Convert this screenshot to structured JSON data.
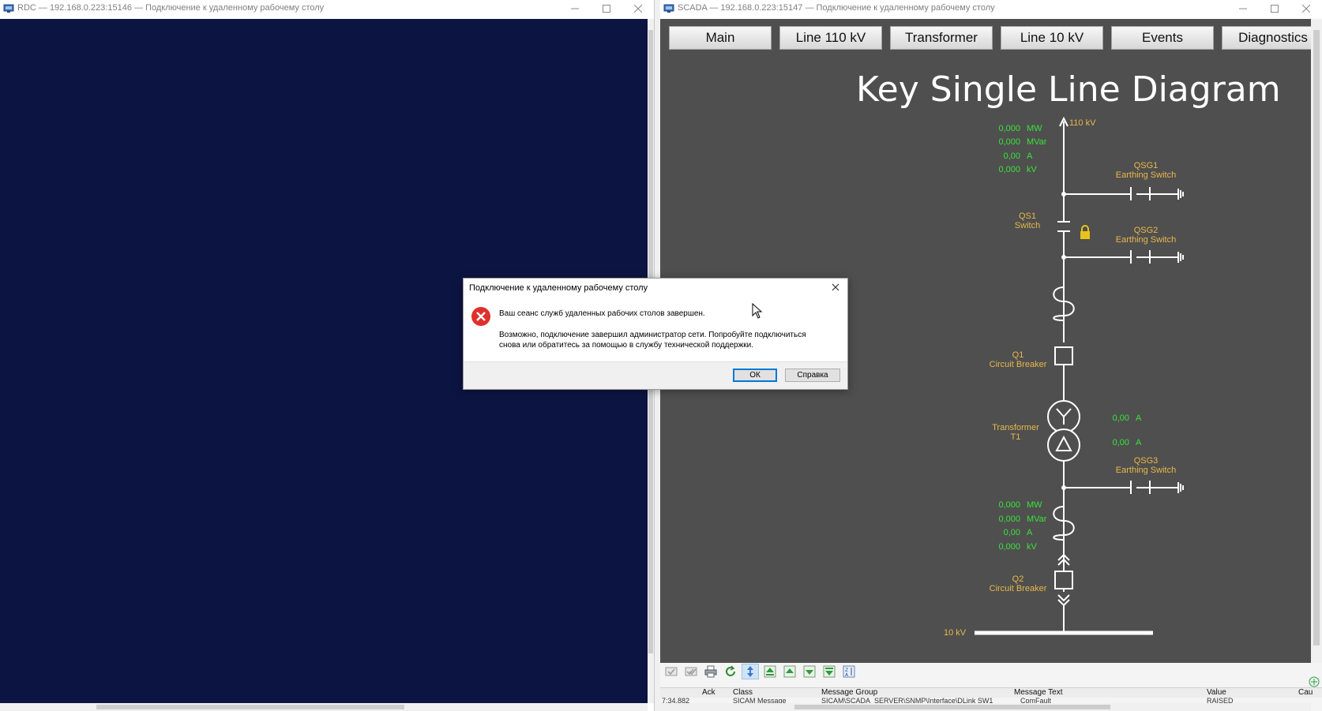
{
  "left_window": {
    "title": "RDC — 192.168.0.223:15146 — Подключение к удаленному рабочему столу"
  },
  "right_window": {
    "title": "SCADA — 192.168.0.223:15147 — Подключение к удаленному рабочему столу"
  },
  "scada": {
    "nav": [
      "Main",
      "Line 110 kV",
      "Transformer",
      "Line 10 kV",
      "Events",
      "Diagnostics"
    ],
    "diagram_title": "Key Single Line Diagram",
    "bus_110": "110 kV",
    "bus_10": "10 kV",
    "meas_top": [
      {
        "value": "0,000",
        "unit": "MW"
      },
      {
        "value": "0,000",
        "unit": "MVar"
      },
      {
        "value": "0,00",
        "unit": "A"
      },
      {
        "value": "0,000",
        "unit": "kV"
      }
    ],
    "meas_bottom": [
      {
        "value": "0,000",
        "unit": "MW"
      },
      {
        "value": "0,000",
        "unit": "MVar"
      },
      {
        "value": "0,00",
        "unit": "A"
      },
      {
        "value": "0,000",
        "unit": "kV"
      }
    ],
    "transformer_currents": [
      {
        "value": "0,00",
        "unit": "A"
      },
      {
        "value": "0,00",
        "unit": "A"
      }
    ],
    "qsg1": {
      "name": "QSG1",
      "desc": "Earthing Switch"
    },
    "qsg2": {
      "name": "QSG2",
      "desc": "Earthing Switch"
    },
    "qsg3": {
      "name": "QSG3",
      "desc": "Earthing Switch"
    },
    "qs1": {
      "name": "QS1",
      "desc": "Switch"
    },
    "q1": {
      "name": "Q1",
      "desc": "Circuit Breaker"
    },
    "q2": {
      "name": "Q2",
      "desc": "Circuit Breaker"
    },
    "t1": {
      "name": "Transformer",
      "desc": "T1"
    },
    "colors": {
      "label": "#e8b84a",
      "measure": "#39e339",
      "background": "#4f4f4f"
    }
  },
  "alarm_panel": {
    "columns": [
      "Ack",
      "Class",
      "Message Group",
      "Message Text",
      "Value",
      "Cau"
    ],
    "row": {
      "time": "7:34.882",
      "class": "SICAM Message",
      "group": "SICAM\\SCADA_SERVER\\SNMP\\Interface\\DLink SW1",
      "text": "ComFault",
      "value": "RAISED"
    }
  },
  "dialog": {
    "title": "Подключение к удаленному рабочему столу",
    "message": "Ваш сеанс служб удаленных рабочих столов завершен.",
    "detail_line1": "Возможно, подключение завершил администратор сети. Попробуйте подключиться",
    "detail_line2": "снова или обратитесь за помощью в службу технической поддержки.",
    "ok_label": "ОК",
    "help_label": "Справка"
  }
}
